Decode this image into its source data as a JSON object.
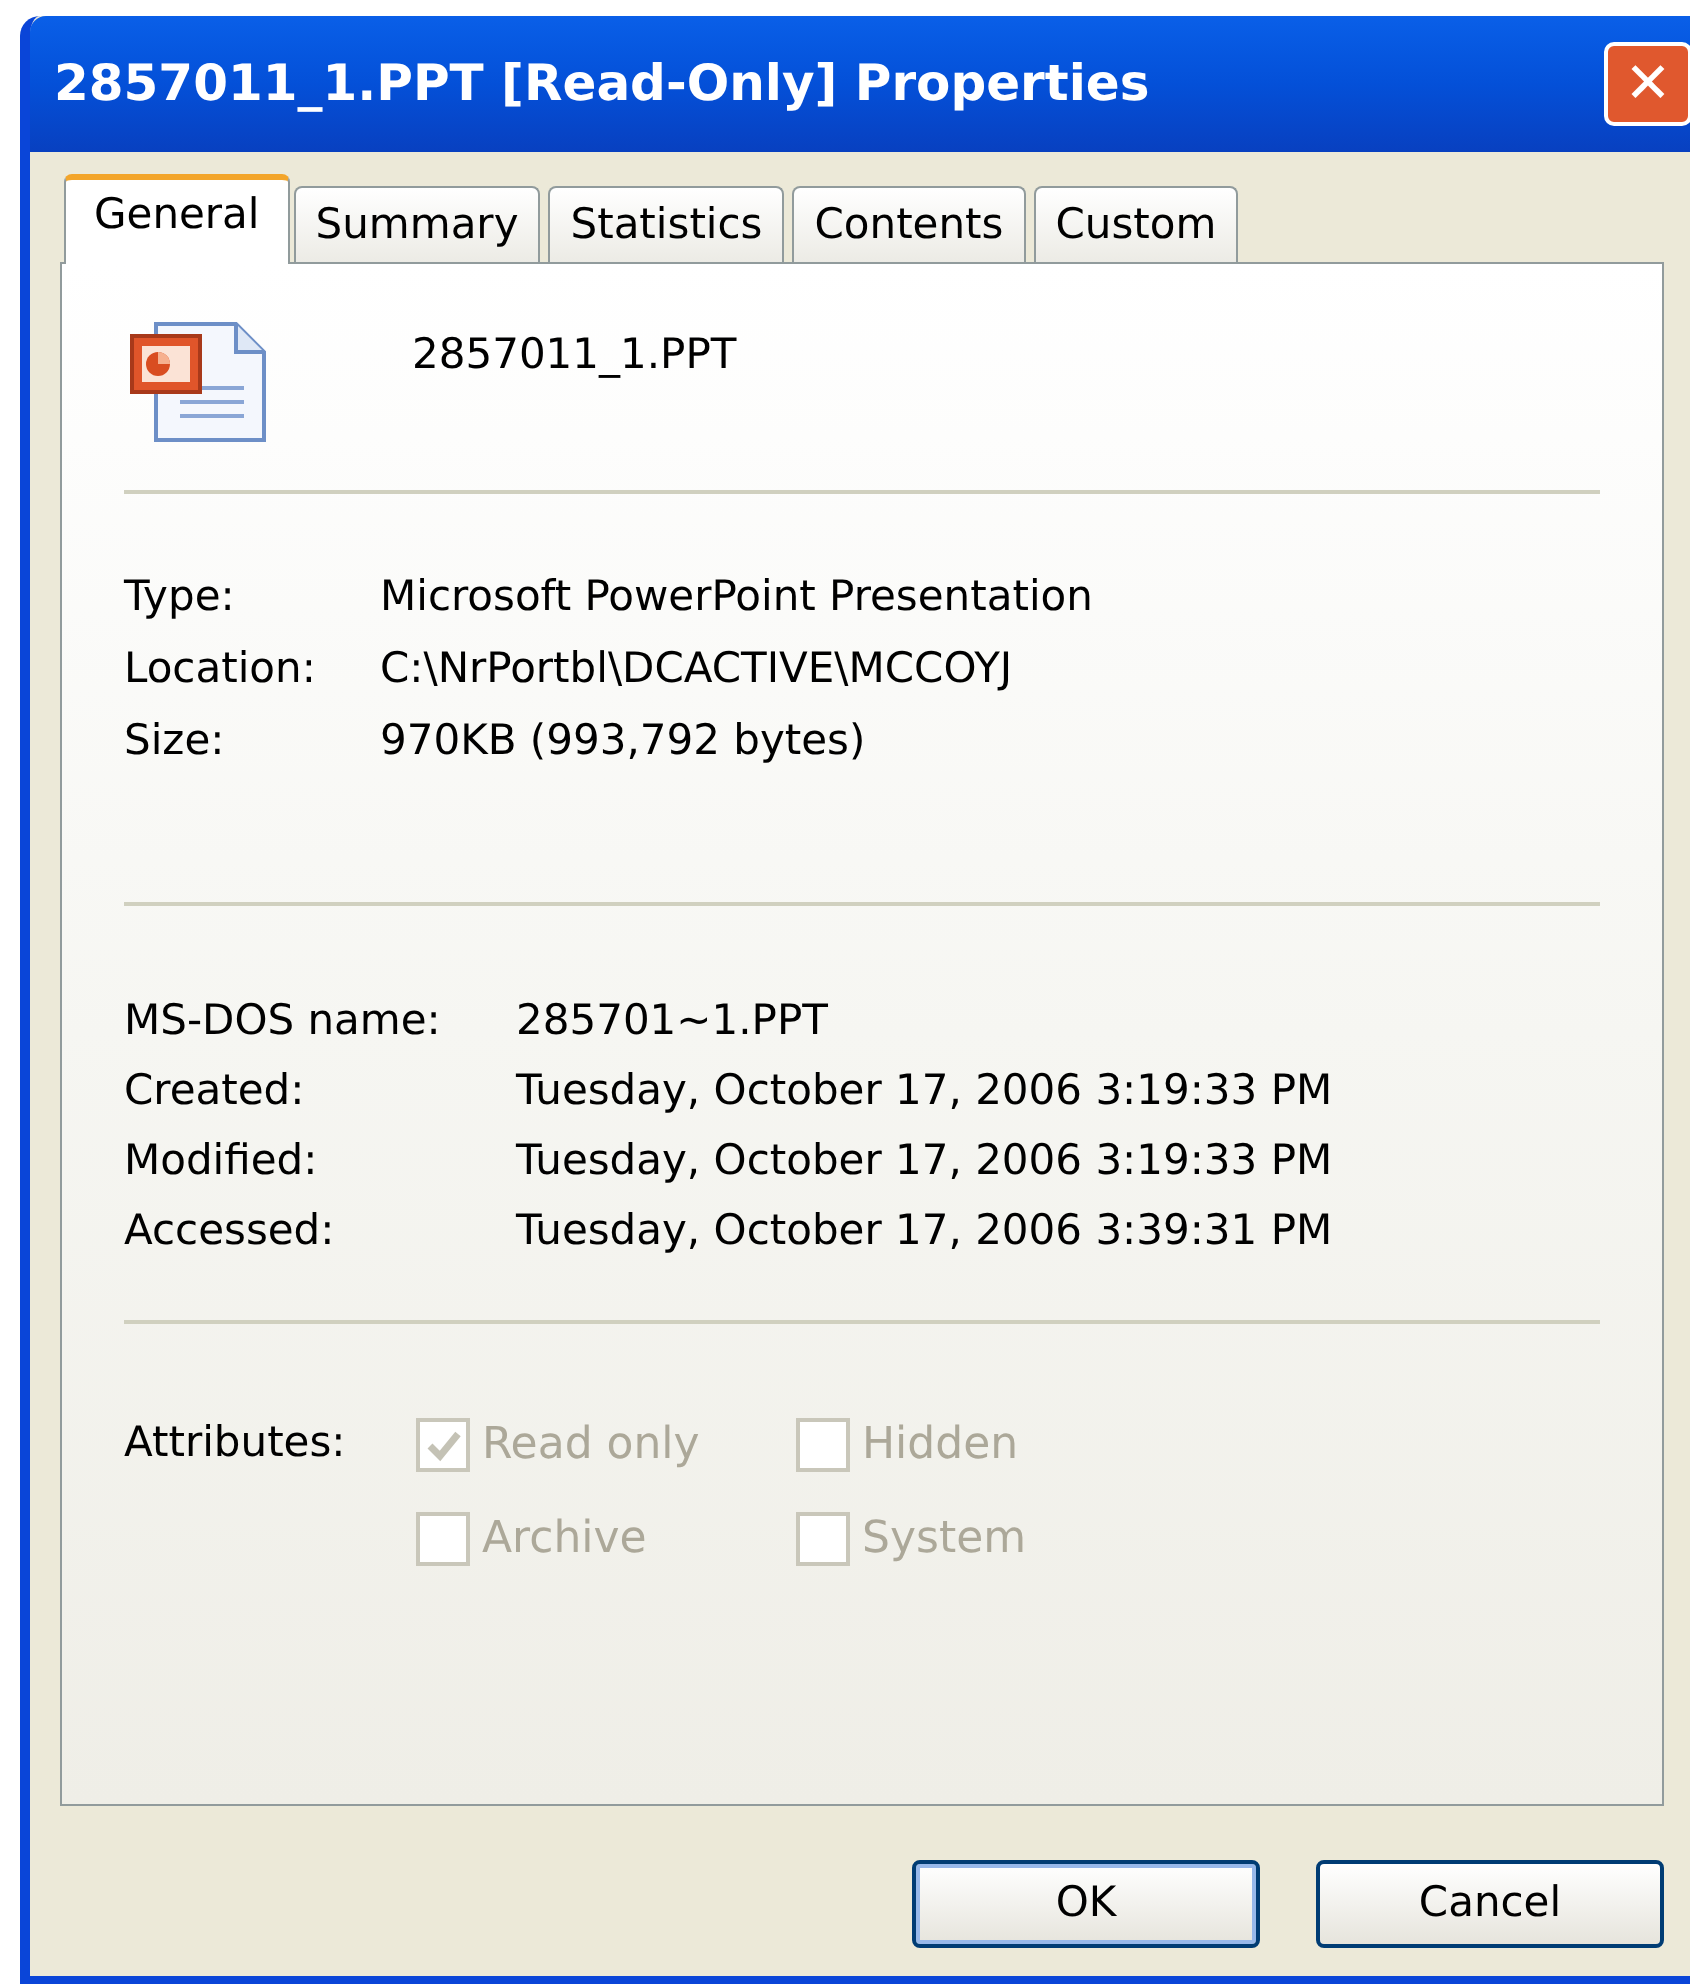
{
  "window": {
    "title": "2857011_1.PPT [Read-Only] Properties",
    "close": "✕"
  },
  "tabs": [
    {
      "label": "General",
      "selected": true
    },
    {
      "label": "Summary",
      "selected": false
    },
    {
      "label": "Statistics",
      "selected": false
    },
    {
      "label": "Contents",
      "selected": false
    },
    {
      "label": "Custom",
      "selected": false
    }
  ],
  "file": {
    "name": "2857011_1.PPT"
  },
  "details": [
    {
      "label": "Type:",
      "value": "Microsoft PowerPoint Presentation"
    },
    {
      "label": "Location:",
      "value": "C:\\NrPortbl\\DCACTIVE\\MCCOYJ"
    },
    {
      "label": "Size:",
      "value": "970KB (993,792 bytes)"
    }
  ],
  "dates": [
    {
      "label": "MS-DOS name:",
      "value": "285701~1.PPT"
    },
    {
      "label": "Created:",
      "value": "Tuesday, October 17, 2006 3:19:33 PM"
    },
    {
      "label": "Modified:",
      "value": "Tuesday, October 17, 2006 3:19:33 PM"
    },
    {
      "label": "Accessed:",
      "value": "Tuesday, October 17, 2006 3:39:31 PM"
    }
  ],
  "attributes": {
    "label": "Attributes:",
    "options": [
      {
        "label": "Read only",
        "checked": true,
        "disabled": true
      },
      {
        "label": "Hidden",
        "checked": false,
        "disabled": true
      },
      {
        "label": "Archive",
        "checked": false,
        "disabled": true
      },
      {
        "label": "System",
        "checked": false,
        "disabled": true
      }
    ]
  },
  "buttons": [
    {
      "label": "OK",
      "default": true
    },
    {
      "label": "Cancel",
      "default": false
    }
  ]
}
